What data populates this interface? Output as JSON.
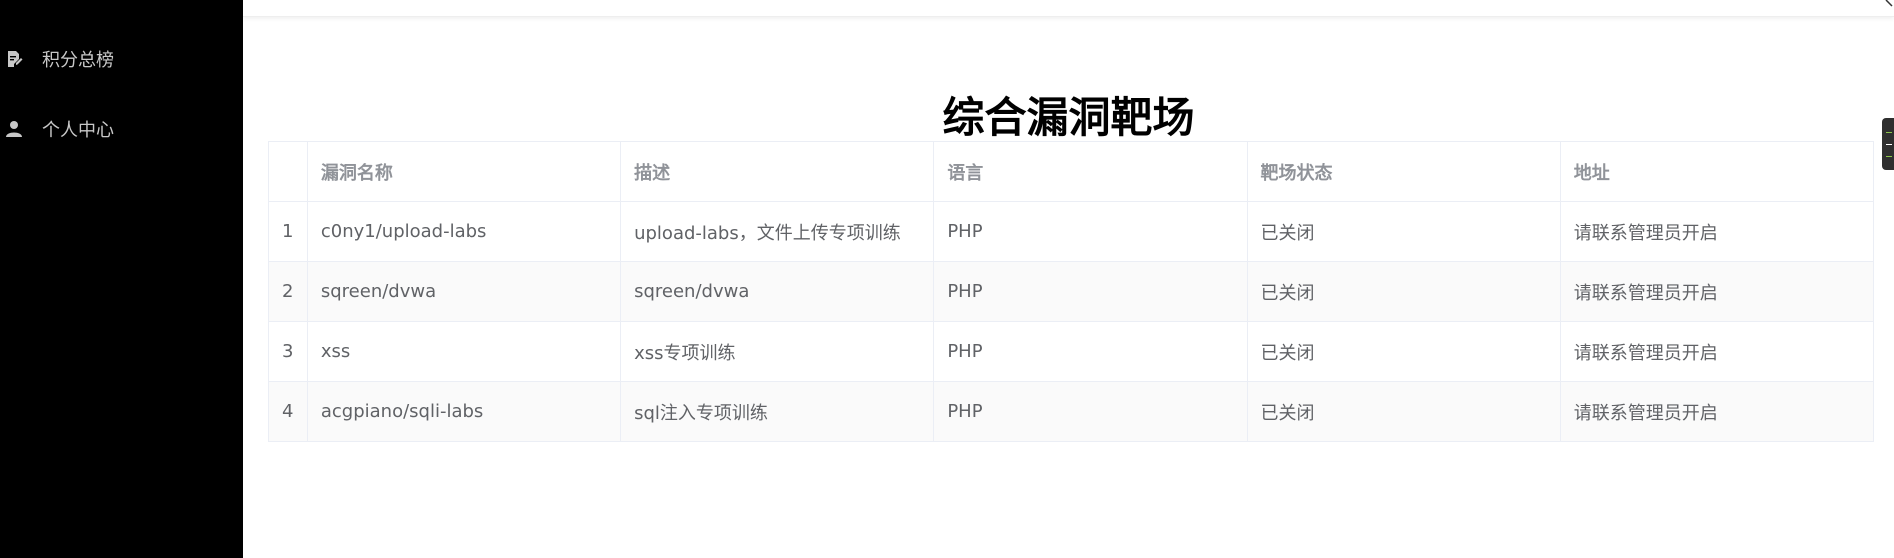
{
  "sidebar": {
    "items": [
      {
        "label": "积分总榜",
        "icon": "document-edit-icon"
      },
      {
        "label": "个人中心",
        "icon": "user-icon"
      }
    ]
  },
  "page": {
    "title": "综合漏洞靶场"
  },
  "table": {
    "headers": [
      "",
      "漏洞名称",
      "描述",
      "语言",
      "靶场状态",
      "地址"
    ],
    "rows": [
      {
        "idx": "1",
        "name": "c0ny1/upload-labs",
        "desc": "upload-labs，文件上传专项训练",
        "lang": "PHP",
        "status": "已关闭",
        "addr": "请联系管理员开启"
      },
      {
        "idx": "2",
        "name": "sqreen/dvwa",
        "desc": "sqreen/dvwa",
        "lang": "PHP",
        "status": "已关闭",
        "addr": "请联系管理员开启"
      },
      {
        "idx": "3",
        "name": "xss",
        "desc": "xss专项训练",
        "lang": "PHP",
        "status": "已关闭",
        "addr": "请联系管理员开启"
      },
      {
        "idx": "4",
        "name": "acgpiano/sqli-labs",
        "desc": "sql注入专项训练",
        "lang": "PHP",
        "status": "已关闭",
        "addr": "请联系管理员开启"
      }
    ]
  },
  "colors": {
    "sidebar_bg": "#000000",
    "sidebar_text": "#c8c8c8",
    "header_text": "#909399",
    "cell_text": "#606266",
    "border": "#ebeef5"
  }
}
